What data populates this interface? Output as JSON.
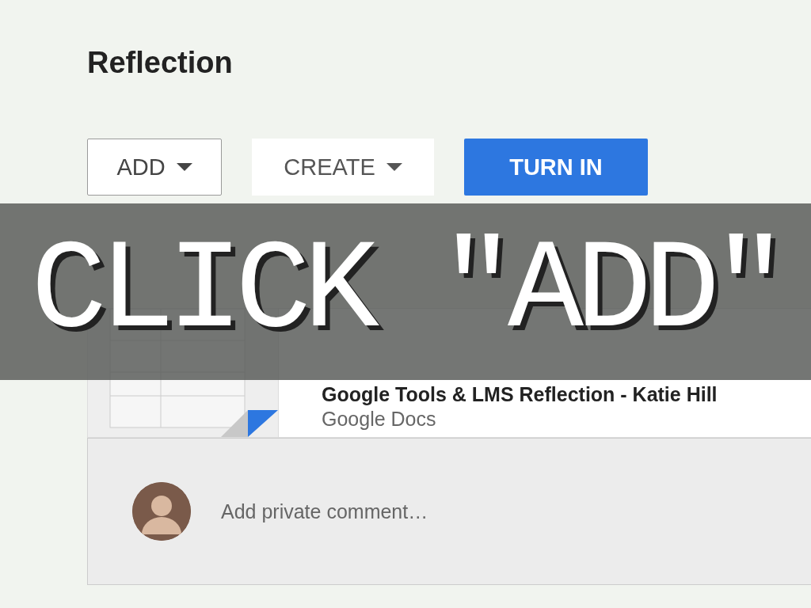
{
  "heading": "Reflection",
  "buttons": [
    {
      "label": "ADD",
      "kind": "outlined",
      "caret": true
    },
    {
      "label": "CREATE",
      "kind": "plain",
      "caret": true
    },
    {
      "label": "TURN IN",
      "kind": "primary",
      "caret": false
    }
  ],
  "attachment": {
    "title": "Google Tools & LMS Reflection - Katie Hill",
    "type": "Google Docs"
  },
  "comment": {
    "placeholder": "Add private comment…"
  },
  "banner": "CLICK \"ADD\""
}
